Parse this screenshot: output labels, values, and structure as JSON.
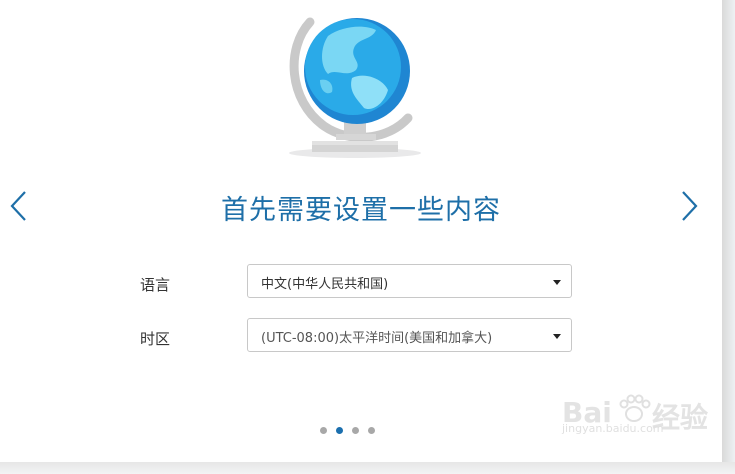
{
  "setup": {
    "title": "首先需要设置一些内容",
    "language": {
      "label": "语言",
      "value": "中文(中华人民共和国)"
    },
    "timezone": {
      "label": "时区",
      "value": "(UTC-08:00)太平洋时间(美国和加拿大)"
    },
    "pagination": {
      "pages": 4,
      "current": 2
    }
  },
  "watermark": {
    "text_left": "Bai",
    "text_right": "经验",
    "url": "jingyan.baidu.com"
  },
  "icons": {
    "prev": "chevron-left-icon",
    "next": "chevron-right-icon",
    "globe": "globe-icon",
    "dropdown": "caret-down-icon"
  },
  "colors": {
    "accent": "#1e6fa8",
    "active_dot": "#1b6fae",
    "inactive_dot": "#a8a8a8"
  }
}
